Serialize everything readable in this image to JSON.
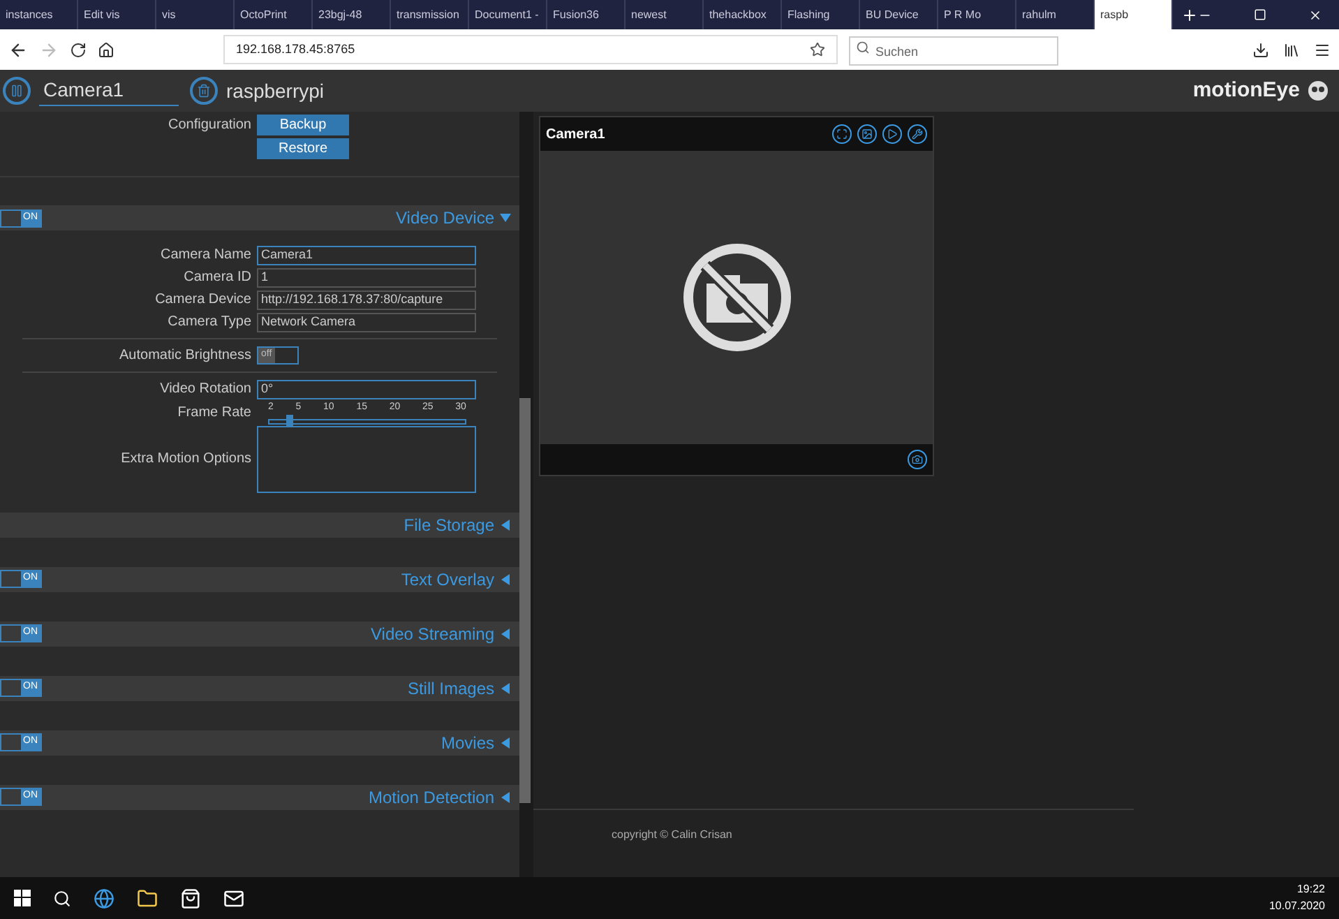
{
  "browser": {
    "tabs": [
      {
        "label": "instances",
        "selected": false
      },
      {
        "label": "Edit vis",
        "selected": false
      },
      {
        "label": "vis",
        "selected": false
      },
      {
        "label": "OctoPrint",
        "selected": false
      },
      {
        "label": "23bgj-48",
        "selected": false
      },
      {
        "label": "transmission",
        "selected": false
      },
      {
        "label": "Document1 -",
        "selected": false
      },
      {
        "label": "Fusion36",
        "selected": false
      },
      {
        "label": "newest",
        "selected": false
      },
      {
        "label": "thehackbox",
        "selected": false
      },
      {
        "label": "Flashing",
        "selected": false
      },
      {
        "label": "BU Device",
        "selected": false
      },
      {
        "label": "P R Mo",
        "selected": false
      },
      {
        "label": "rahulm",
        "selected": false
      },
      {
        "label": "raspb",
        "selected": true
      }
    ],
    "url": "192.168.178.45:8765",
    "search": {
      "placeholder": "Suchen"
    }
  },
  "header": {
    "camera_select": "Camera1",
    "host": "raspberrypi",
    "brand": "motionEye"
  },
  "settings": {
    "config_label": "Configuration",
    "buttons": [
      "Backup",
      "Restore"
    ],
    "video_device": {
      "title": "Video Device",
      "expanded": true,
      "toggle": {
        "label": "ON",
        "on": true
      },
      "groups": [
        [
          {
            "kind": "text",
            "label": "Camera Name",
            "value": "Camera1",
            "readonly": false
          },
          {
            "kind": "text",
            "label": "Camera ID",
            "value": "1",
            "readonly": true
          },
          {
            "kind": "text",
            "label": "Camera Device",
            "value": "http://192.168.178.37:80/capture",
            "readonly": true
          },
          {
            "kind": "text",
            "label": "Camera Type",
            "value": "Network Camera",
            "readonly": true
          }
        ],
        [
          {
            "kind": "toggle",
            "label": "Automatic Brightness",
            "toggle": {
              "label": "off",
              "on": false
            }
          }
        ],
        [
          {
            "kind": "text",
            "label": "Video Rotation",
            "value": "0°",
            "readonly": false
          },
          {
            "kind": "slider",
            "label": "Frame Rate",
            "ticks": [
              "2",
              "5",
              "10",
              "15",
              "20",
              "25",
              "30"
            ],
            "level": 0.1
          },
          {
            "kind": "textarea",
            "label": "Extra Motion Options"
          }
        ]
      ]
    },
    "sections": [
      {
        "title": "File Storage",
        "expanded": false
      },
      {
        "title": "Text Overlay",
        "expanded": false,
        "toggle": {
          "label": "ON",
          "on": true
        }
      },
      {
        "title": "Video Streaming",
        "expanded": false,
        "toggle": {
          "label": "ON",
          "on": true
        }
      },
      {
        "title": "Still Images",
        "expanded": false,
        "toggle": {
          "label": "ON",
          "on": true
        }
      },
      {
        "title": "Movies",
        "expanded": false,
        "toggle": {
          "label": "ON",
          "on": true
        }
      },
      {
        "title": "Motion Detection",
        "expanded": false,
        "toggle": {
          "label": "ON",
          "on": true
        }
      }
    ]
  },
  "camera": {
    "title": "Camera1"
  },
  "footer": "copyright © Calin Crisan",
  "taskbar": {
    "time": "19:22",
    "date": "10.07.2020"
  }
}
